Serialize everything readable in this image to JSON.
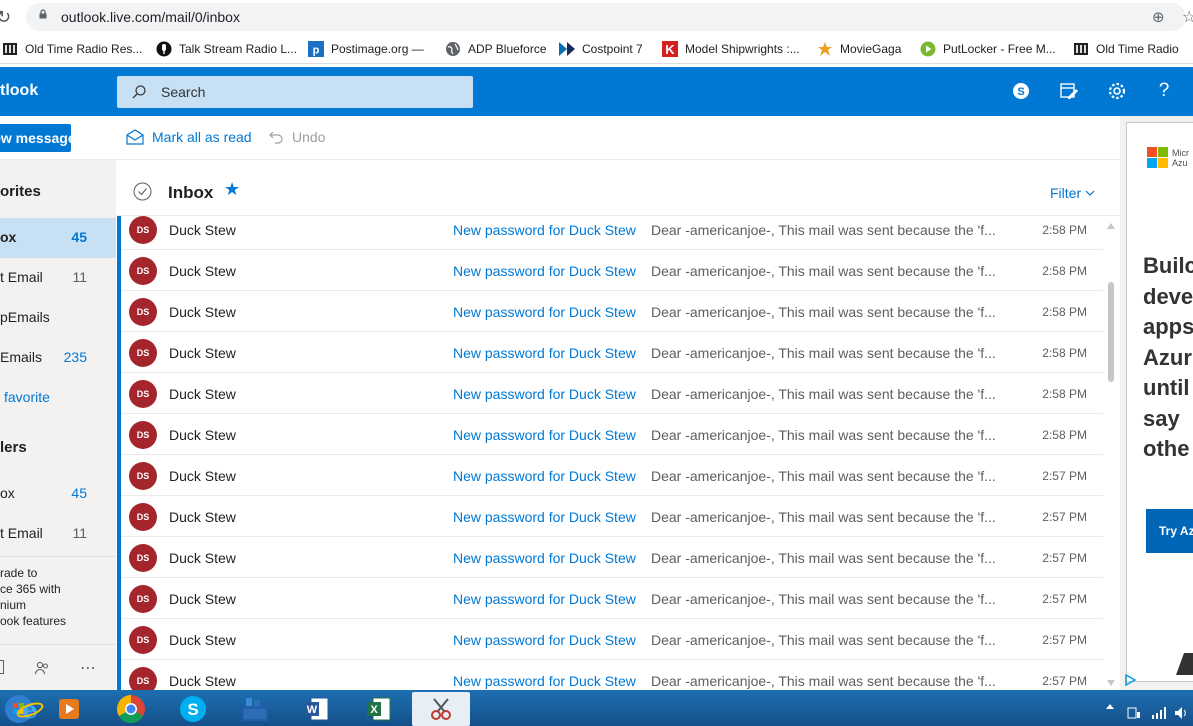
{
  "browser": {
    "url": "outlook.live.com/mail/0/inbox",
    "bookmarks": [
      {
        "label": "Old Time Radio Res...",
        "icon": "old-time-radio-icon"
      },
      {
        "label": "Talk Stream Radio L...",
        "icon": "microphone-icon"
      },
      {
        "label": "Postimage.org —",
        "icon": "postimage-icon"
      },
      {
        "label": "ADP Blueforce",
        "icon": "globe-icon"
      },
      {
        "label": "Costpoint 7",
        "icon": "costpoint-icon"
      },
      {
        "label": "Model Shipwrights :...",
        "icon": "model-shipwrights-icon"
      },
      {
        "label": "MovieGaga",
        "icon": "moviegaga-icon"
      },
      {
        "label": "PutLocker - Free M...",
        "icon": "putlocker-icon"
      },
      {
        "label": "Old Time Radio",
        "icon": "old-time-radio-icon"
      }
    ]
  },
  "header": {
    "brand": "tlook",
    "search_placeholder": "Search"
  },
  "commandbar": {
    "new_message": "New message",
    "mark_all_read": "Mark all as read",
    "undo": "Undo"
  },
  "sidebar": {
    "favorites_label": "orites",
    "favorites": [
      {
        "label": "ox",
        "count": "45"
      },
      {
        "label": "t Email",
        "count": "11"
      },
      {
        "label": "pEmails",
        "count": ""
      },
      {
        "label": "Emails",
        "count": "235"
      },
      {
        "label": "favorite",
        "count": ""
      }
    ],
    "folders_label": "lers",
    "folders": [
      {
        "label": "ox",
        "count": "45"
      },
      {
        "label": "t Email",
        "count": "11"
      }
    ],
    "upgrade_lines": [
      "rade to",
      "ce 365 with",
      "nium",
      "ook features"
    ]
  },
  "inbox": {
    "title": "Inbox",
    "filter_label": "Filter"
  },
  "messages": [
    {
      "initials": "DS",
      "sender": "Duck Stew",
      "subject": "New password for Duck Stew",
      "preview": "Dear -americanjoe-, This mail was sent because the 'f...",
      "time": "2:58 PM"
    },
    {
      "initials": "DS",
      "sender": "Duck Stew",
      "subject": "New password for Duck Stew",
      "preview": "Dear -americanjoe-, This mail was sent because the 'f...",
      "time": "2:58 PM"
    },
    {
      "initials": "DS",
      "sender": "Duck Stew",
      "subject": "New password for Duck Stew",
      "preview": "Dear -americanjoe-, This mail was sent because the 'f...",
      "time": "2:58 PM"
    },
    {
      "initials": "DS",
      "sender": "Duck Stew",
      "subject": "New password for Duck Stew",
      "preview": "Dear -americanjoe-, This mail was sent because the 'f...",
      "time": "2:58 PM"
    },
    {
      "initials": "DS",
      "sender": "Duck Stew",
      "subject": "New password for Duck Stew",
      "preview": "Dear -americanjoe-, This mail was sent because the 'f...",
      "time": "2:58 PM"
    },
    {
      "initials": "DS",
      "sender": "Duck Stew",
      "subject": "New password for Duck Stew",
      "preview": "Dear -americanjoe-, This mail was sent because the 'f...",
      "time": "2:58 PM"
    },
    {
      "initials": "DS",
      "sender": "Duck Stew",
      "subject": "New password for Duck Stew",
      "preview": "Dear -americanjoe-, This mail was sent because the 'f...",
      "time": "2:57 PM"
    },
    {
      "initials": "DS",
      "sender": "Duck Stew",
      "subject": "New password for Duck Stew",
      "preview": "Dear -americanjoe-, This mail was sent because the 'f...",
      "time": "2:57 PM"
    },
    {
      "initials": "DS",
      "sender": "Duck Stew",
      "subject": "New password for Duck Stew",
      "preview": "Dear -americanjoe-, This mail was sent because the 'f...",
      "time": "2:57 PM"
    },
    {
      "initials": "DS",
      "sender": "Duck Stew",
      "subject": "New password for Duck Stew",
      "preview": "Dear -americanjoe-, This mail was sent because the 'f...",
      "time": "2:57 PM"
    },
    {
      "initials": "DS",
      "sender": "Duck Stew",
      "subject": "New password for Duck Stew",
      "preview": "Dear -americanjoe-, This mail was sent because the 'f...",
      "time": "2:57 PM"
    },
    {
      "initials": "DS",
      "sender": "Duck Stew",
      "subject": "New password for Duck Stew",
      "preview": "Dear -americanjoe-, This mail was sent because the 'f...",
      "time": "2:57 PM"
    }
  ],
  "ad": {
    "brand": "Micr Azu",
    "headline_lines": [
      "Builc",
      "deve",
      "apps",
      "Azur",
      "until",
      "say",
      "othe"
    ],
    "cta": "Try Azu"
  },
  "colors": {
    "accent": "#0078d4",
    "avatar": "#a4262c",
    "nav_bg": "#f3f2f1",
    "selected_nav": "#c7e0f4"
  }
}
